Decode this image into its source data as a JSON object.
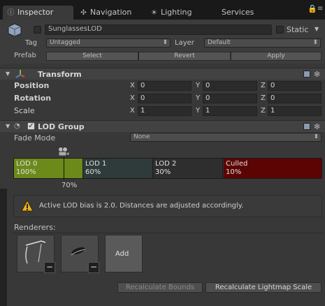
{
  "tabs": [
    {
      "label": "Inspector",
      "icon": "info-icon"
    },
    {
      "label": "Navigation",
      "icon": "compass-icon"
    },
    {
      "label": "Lighting",
      "icon": "sun-icon"
    },
    {
      "label": "Services",
      "icon": ""
    }
  ],
  "object": {
    "name": "SunglassesLOD",
    "static_label": "Static",
    "tag_label": "Tag",
    "tag_value": "Untagged",
    "layer_label": "Layer",
    "layer_value": "Default",
    "prefab_label": "Prefab",
    "select_label": "Select",
    "revert_label": "Revert",
    "apply_label": "Apply"
  },
  "transform": {
    "title": "Transform",
    "rows": [
      {
        "label": "Position",
        "x": "0",
        "y": "0",
        "z": "0"
      },
      {
        "label": "Rotation",
        "x": "0",
        "y": "0",
        "z": "0"
      },
      {
        "label": "Scale",
        "x": "1",
        "y": "1",
        "z": "1"
      }
    ],
    "axis": {
      "x": "X",
      "y": "Y",
      "z": "Z"
    }
  },
  "lod_group": {
    "title": "LOD Group",
    "fade_mode_label": "Fade Mode",
    "fade_mode_value": "None",
    "levels": [
      {
        "name": "LOD 0",
        "percent": "100%",
        "color": "#6c8a1a"
      },
      {
        "name": "LOD 1",
        "percent": "60%",
        "color": "#2f3a3a"
      },
      {
        "name": "LOD 2",
        "percent": "30%",
        "color": "#2e2e2e"
      },
      {
        "name": "Culled",
        "percent": "10%",
        "color": "#5c0404"
      }
    ],
    "cursor_percent": "70%",
    "warning": "Active LOD bias is 2.0. Distances are adjusted accordingly.",
    "renderers_label": "Renderers:",
    "add_label": "Add",
    "recalc_bounds": "Recalculate Bounds",
    "recalc_lightmap": "Recalculate Lightmap Scale"
  }
}
